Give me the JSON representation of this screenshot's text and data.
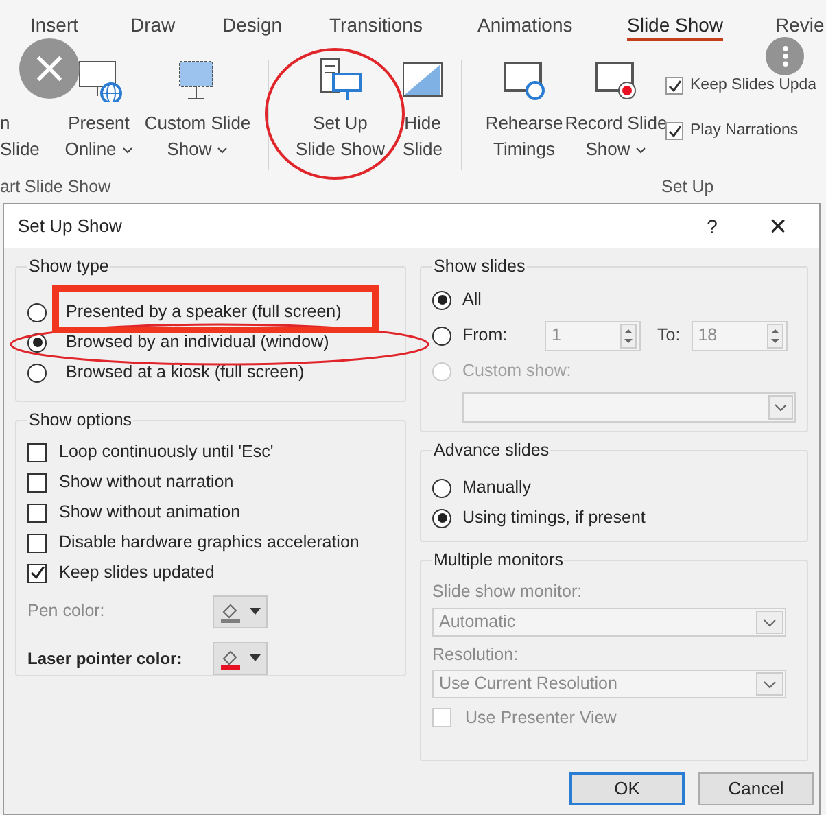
{
  "ribbon": {
    "tabs": [
      {
        "label": "Insert",
        "selected": false
      },
      {
        "label": "Draw",
        "selected": false
      },
      {
        "label": "Design",
        "selected": false
      },
      {
        "label": "Transitions",
        "selected": false
      },
      {
        "label": "Animations",
        "selected": false
      },
      {
        "label": "Slide Show",
        "selected": true
      },
      {
        "label": "Revie",
        "selected": false
      }
    ],
    "commands": [
      {
        "lines": [
          "n",
          "Slide"
        ],
        "dropdown": false
      },
      {
        "lines": [
          "Present",
          "Online"
        ],
        "dropdown": true
      },
      {
        "lines": [
          "Custom Slide",
          "Show"
        ],
        "dropdown": true
      },
      {
        "lines": [
          "Set Up",
          "Slide Show"
        ],
        "dropdown": false
      },
      {
        "lines": [
          "Hide",
          "Slide"
        ],
        "dropdown": false
      },
      {
        "lines": [
          "Rehearse",
          "Timings"
        ],
        "dropdown": false
      },
      {
        "lines": [
          "Record Slide",
          "Show"
        ],
        "dropdown": true
      }
    ],
    "checkboxes": [
      {
        "label": "Keep Slides Upda",
        "checked": true
      },
      {
        "label": "Play Narrations",
        "checked": true
      }
    ],
    "groups": [
      "art Slide Show",
      "Set Up"
    ]
  },
  "dialog": {
    "title": "Set Up Show",
    "help": "?",
    "close": "×",
    "show_type": {
      "title": "Show type",
      "options": [
        {
          "label": "Presented by a speaker (full screen)",
          "selected": false
        },
        {
          "label": "Browsed by an individual (window)",
          "selected": true
        },
        {
          "label": "Browsed at a kiosk (full screen)",
          "selected": false
        }
      ]
    },
    "show_options": {
      "title": "Show options",
      "checkboxes": [
        {
          "label": "Loop continuously until 'Esc'",
          "checked": false
        },
        {
          "label": "Show without narration",
          "checked": false
        },
        {
          "label": "Show without animation",
          "checked": false
        },
        {
          "label": "Disable hardware graphics acceleration",
          "checked": false
        },
        {
          "label": "Keep slides updated",
          "checked": true
        }
      ],
      "color_pickers": [
        {
          "label": "Pen color:",
          "disabled": true,
          "color": "#7f7f7f"
        },
        {
          "label": "Laser pointer color:",
          "disabled": false,
          "color": "#e81123"
        }
      ]
    },
    "show_slides": {
      "title": "Show slides",
      "options": [
        {
          "label": "All",
          "selected": true,
          "disabled": false
        },
        {
          "label": "From:",
          "selected": false,
          "disabled": false
        },
        {
          "label": "Custom show:",
          "selected": false,
          "disabled": true
        }
      ],
      "from": "1",
      "to_label": "To:",
      "to": "18"
    },
    "advance_slides": {
      "title": "Advance slides",
      "options": [
        {
          "label": "Manually",
          "selected": false
        },
        {
          "label": "Using timings, if present",
          "selected": true
        }
      ]
    },
    "multiple_monitors": {
      "title": "Multiple monitors",
      "monitor_label": "Slide show monitor:",
      "monitor_value": "Automatic",
      "resolution_label": "Resolution:",
      "resolution_value": "Use Current Resolution",
      "presenter": {
        "label": "Use Presenter View",
        "checked": false
      }
    },
    "buttons": [
      {
        "label": "OK",
        "default": true
      },
      {
        "label": "Cancel",
        "default": false
      }
    ]
  }
}
